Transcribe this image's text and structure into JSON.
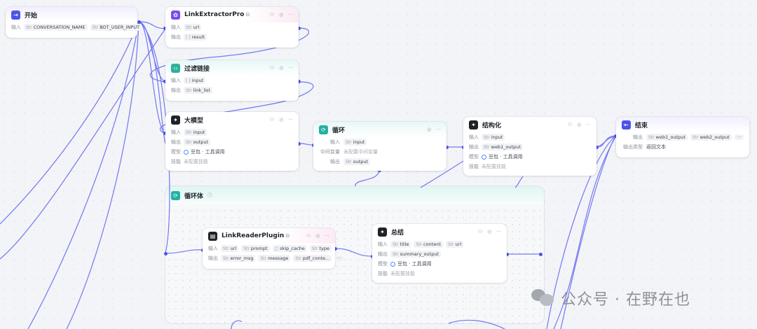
{
  "nodes": {
    "start": {
      "title": "开始",
      "output_label": "输入",
      "vars": [
        {
          "type": "Str",
          "name": "CONVERSATION_NAME"
        },
        {
          "type": "Str",
          "name": "BOT_USER_INPUT"
        }
      ]
    },
    "link_extractor": {
      "title": "LinkExtractorPro",
      "badge": "⊟",
      "input_label": "输入",
      "output_label": "输出",
      "inputs": [
        {
          "type": "Str",
          "name": "url"
        }
      ],
      "outputs": [
        {
          "type": "[ ]",
          "name": "result"
        }
      ]
    },
    "filter_links": {
      "title": "过滤链接",
      "input_label": "输入",
      "output_label": "输出",
      "inputs": [
        {
          "type": "[ ]",
          "name": "input"
        }
      ],
      "outputs": [
        {
          "type": "Str",
          "name": "link_list"
        }
      ]
    },
    "llm": {
      "title": "大模型",
      "input_label": "输入",
      "output_label": "输出",
      "model_label": "模型",
      "skill_label": "技能",
      "inputs": [
        {
          "type": "Str",
          "name": "input"
        }
      ],
      "outputs": [
        {
          "type": "Str",
          "name": "output"
        }
      ],
      "model": "豆包 · 工具调用",
      "skill": "未配置技能"
    },
    "loop": {
      "title": "循环",
      "input_label": "输入",
      "mid_label": "中间变量",
      "output_label": "输出",
      "inputs": [
        {
          "type": "Str",
          "name": "input"
        }
      ],
      "mid_value": "未配置中间变量",
      "outputs": [
        {
          "type": "Str",
          "name": "output"
        }
      ]
    },
    "structure": {
      "title": "结构化",
      "input_label": "输入",
      "output_label": "输出",
      "model_label": "模型",
      "skill_label": "技能",
      "inputs": [
        {
          "type": "Str",
          "name": "input"
        }
      ],
      "outputs": [
        {
          "type": "Str",
          "name": "web1_output"
        }
      ],
      "model": "豆包 · 工具调用",
      "skill": "未配置技能"
    },
    "end": {
      "title": "结束",
      "output_label": "输出",
      "output_type_label": "输出类型",
      "outputs": [
        {
          "type": "Str",
          "name": "web1_output"
        },
        {
          "type": "Str",
          "name": "web2_output"
        }
      ],
      "output_type": "返回文本"
    },
    "loop_body": {
      "title": "循环体",
      "info_icon": "ⓘ"
    },
    "link_reader": {
      "title": "LinkReaderPlugin",
      "badge": "⊟",
      "input_label": "输入",
      "output_label": "输出",
      "inputs": [
        {
          "type": "Str",
          "name": "url"
        },
        {
          "type": "Str",
          "name": "prompt"
        },
        {
          "type": "□",
          "name": "skip_cache"
        },
        {
          "type": "Str",
          "name": "type"
        }
      ],
      "outputs": [
        {
          "type": "Str",
          "name": "error_msg"
        },
        {
          "type": "Str",
          "name": "message"
        },
        {
          "type": "Str",
          "name": "pdf_conte..."
        }
      ]
    },
    "summary": {
      "title": "总结",
      "input_label": "输入",
      "output_label": "输出",
      "model_label": "模型",
      "skill_label": "技能",
      "inputs": [
        {
          "type": "Str",
          "name": "title"
        },
        {
          "type": "Str",
          "name": "content"
        },
        {
          "type": "Str",
          "name": "url"
        }
      ],
      "outputs": [
        {
          "type": "Str",
          "name": "summary_output"
        }
      ],
      "model": "豆包 · 工具调用",
      "skill": "未配置技能"
    }
  },
  "icons": {
    "start": "start-icon",
    "plugin": "plugin-icon",
    "code": "code-icon",
    "llm": "llm-icon",
    "loop": "loop-icon",
    "end": "end-icon"
  },
  "colors": {
    "edge": "#4d53e8",
    "accent": "#4d53e8",
    "loop_green": "#22b2a3"
  },
  "watermark": {
    "text": "公众号 · 在野在也"
  }
}
